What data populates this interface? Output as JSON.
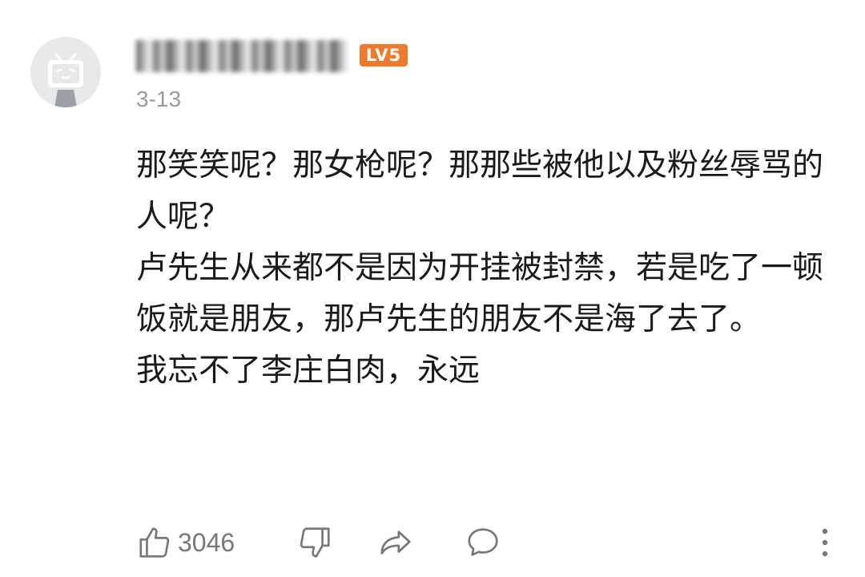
{
  "comment": {
    "user": {
      "level_badge": "LV5",
      "avatar_icon": "tv-mascot-icon"
    },
    "date": "3-13",
    "paragraphs": [
      "那笑笑呢？那女枪呢？那那些被他以及粉丝辱骂的人呢？",
      "卢先生从来都不是因为开挂被封禁，若是吃了一顿饭就是朋友，那卢先生的朋友不是海了去了。",
      "我忘不了李庄白肉，永远"
    ],
    "actions": {
      "like_count": "3046",
      "like_icon": "thumbs-up-icon",
      "dislike_icon": "thumbs-down-icon",
      "share_icon": "share-icon",
      "reply_icon": "comment-icon",
      "more_icon": "more-vertical-icon"
    },
    "colors": {
      "level_badge": "#f07a2b",
      "text": "#1a1a1a",
      "secondary": "#9a9a9a",
      "icon": "#777777"
    }
  }
}
